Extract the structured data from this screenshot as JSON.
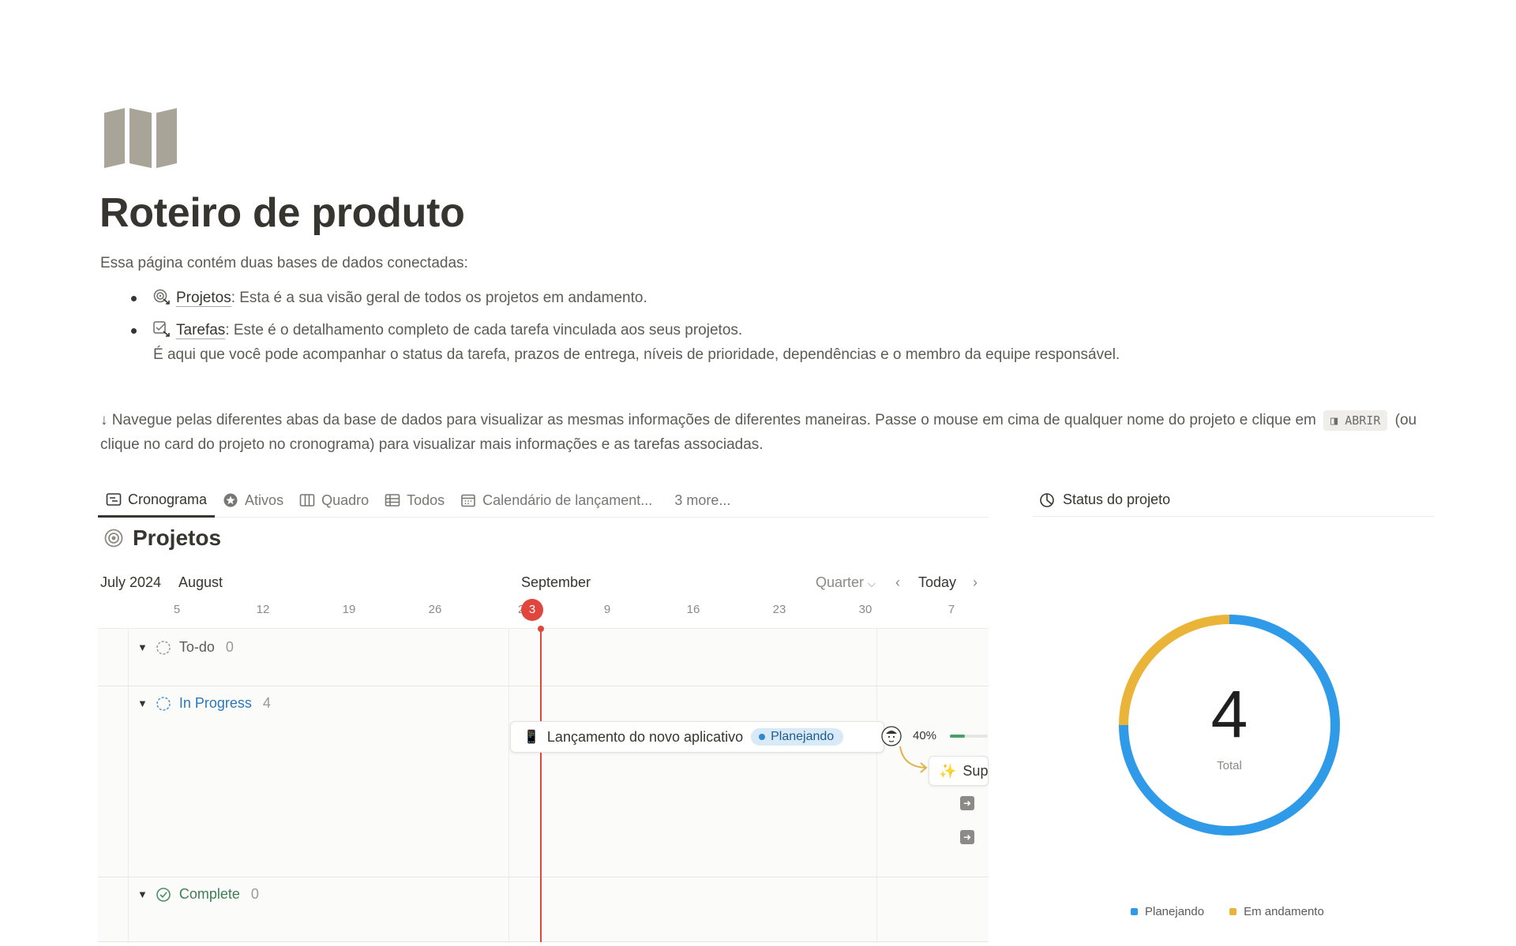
{
  "page": {
    "icon": "map-icon",
    "title": "Roteiro de produto",
    "intro": "Essa página contém duas bases de dados conectadas:",
    "bullets": [
      {
        "icon": "target-link-icon",
        "name": "Projetos",
        "text": ": Esta é a sua visão geral de todos os projetos em andamento."
      },
      {
        "icon": "checkbox-link-icon",
        "name": "Tarefas",
        "text": ": Este é o detalhamento completo de cada tarefa vinculada aos seus projetos.",
        "extra": "É aqui que você pode acompanhar o status da tarefa, prazos de entrega, níveis de prioridade, dependências e o membro da equipe responsável."
      }
    ],
    "nav_text_1": "↓ Navegue pelas diferentes abas da base de dados para visualizar as mesmas informações de diferentes maneiras. Passe o mouse em cima de qualquer nome do projeto e clique em",
    "nav_code": "ABRIR",
    "nav_text_2": "(ou clique no card do projeto no cronograma) para visualizar mais informações e as tarefas associadas."
  },
  "tabs": [
    {
      "label": "Cronograma",
      "icon": "timeline-icon",
      "active": true
    },
    {
      "label": "Ativos",
      "icon": "star-icon"
    },
    {
      "label": "Quadro",
      "icon": "board-icon"
    },
    {
      "label": "Todos",
      "icon": "table-icon"
    },
    {
      "label": "Calendário de lançament...",
      "icon": "calendar-icon"
    },
    {
      "label": "3 more..."
    }
  ],
  "database": {
    "title": "Projetos",
    "icon": "target-icon"
  },
  "timeline": {
    "months": [
      "July 2024",
      "August",
      "September"
    ],
    "controls": {
      "range": "Quarter",
      "today": "Today"
    },
    "days": [
      "5",
      "12",
      "19",
      "26",
      "2",
      "9",
      "16",
      "23",
      "30",
      "7"
    ],
    "today_day": "3",
    "groups": [
      {
        "name": "To-do",
        "count": "0"
      },
      {
        "name": "In Progress",
        "count": "4"
      },
      {
        "name": "Complete",
        "count": "0"
      }
    ],
    "project": {
      "icon": "phone-icon",
      "name": "Lançamento do novo aplicativo",
      "status": "Planejando",
      "progress_label": "40%",
      "progress": 0.4
    },
    "subtask_label": "Sup"
  },
  "status_chart": {
    "title": "Status do projeto",
    "total": "4",
    "total_label": "Total"
  },
  "chart_data": {
    "type": "pie",
    "donut": true,
    "categories": [
      "Planejando",
      "Em andamento"
    ],
    "values": [
      3,
      1
    ],
    "colors": [
      "#2f9be8",
      "#e9b437"
    ],
    "legend": "bottom"
  }
}
